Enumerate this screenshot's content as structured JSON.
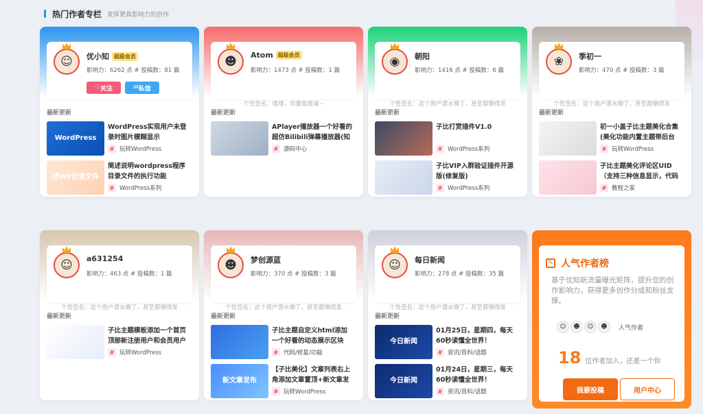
{
  "section": {
    "title": "热门作者专栏",
    "subtitle": "发挥更具影响力的创作"
  },
  "labels": {
    "recent": "最新更新",
    "stats_fmt_points": "影响力",
    "follow": "关注",
    "message": "私信"
  },
  "authors": [
    {
      "name": "优小知",
      "badge": "超级会员",
      "stats": "影响力：6262 点 # 投稿数：81 篇",
      "signature": "",
      "theme": "#2d95ee",
      "posts": [
        {
          "title": "WordPress实现用户未登录时图片模糊显示",
          "tag": "玩转WordPress",
          "thumb": "WordPress"
        },
        {
          "title": "简述说明wordpress程序目录文件的执行功能",
          "tag": "WordPress系列",
          "thumb": "述WP目录文件"
        }
      ]
    },
    {
      "name": "Atom",
      "badge": "超级会员",
      "stats": "影响力：1473 点 # 投稿数：1 篇",
      "signature": "个性签名：嘻嘻，你要我是谁~",
      "theme": "#f56b6b",
      "posts": [
        {
          "title": "APlayer播放器一个好看的超仿Bilibili弹幕播放器(知",
          "tag": "源码中心",
          "thumb": ""
        }
      ]
    },
    {
      "name": "朝阳",
      "badge": "",
      "stats": "影响力：1416 点 # 投稿数：6 篇",
      "signature": "个性签名：这个用户潜水懒了，甚至都懒得发",
      "theme": "#1dd27a",
      "posts": [
        {
          "title": "子比打赏插件V1.0",
          "tag": "WordPress系列",
          "thumb": ""
        },
        {
          "title": "子比VIP入群验证插件开源版(修复版)",
          "tag": "WordPress系列",
          "thumb": ""
        }
      ]
    },
    {
      "name": "季初一",
      "badge": "",
      "stats": "影响力：470 点 # 投稿数：3 篇",
      "signature": "个性签名：这个用户潜水懒了，甚至都懒得发",
      "theme": "#b7afa9",
      "posts": [
        {
          "title": "初一小盖子比主题美化合集(美化功能内置主题带后台",
          "tag": "玩转WordPress",
          "thumb": ""
        },
        {
          "title": "子比主题美化评论区UID（支持三种信息显示，代码",
          "tag": "教程之家",
          "thumb": ""
        }
      ]
    },
    {
      "name": "a631254",
      "badge": "",
      "stats": "影响力：463 点 # 投稿数：1 篇",
      "signature": "个性签名：这个用户潜水懒了，甚至都懒得发",
      "theme": "#d8c6b1",
      "posts": [
        {
          "title": "子比主题模板添加一个首页顶部新注册用户和会员用户",
          "tag": "玩转WordPress",
          "thumb": ""
        }
      ]
    },
    {
      "name": "梦创源蓝",
      "badge": "",
      "stats": "影响力：370 点 # 投稿数：3 篇",
      "signature": "个性签名：这个用户潜水懒了，甚至都懒得发",
      "theme": "#e7b7b7",
      "posts": [
        {
          "title": "子比主题自定义html添加一个好看的动态展示区块",
          "tag": "代码/修复/功能",
          "thumb": ""
        },
        {
          "title": "【子比美化】文章列表右上角添加文章置顶+新文章发",
          "tag": "玩转WordPress",
          "thumb": "新文章发布"
        }
      ]
    },
    {
      "name": "每日新闻",
      "badge": "",
      "stats": "影响力：278 点 # 投稿数：35 篇",
      "signature": "个性签名：这个用户潜水懒了，甚至都懒得发",
      "theme": "#cfd0dc",
      "posts": [
        {
          "title": "01月25日，星期四，每天60秒读懂全世界！",
          "tag": "资讯/百科/话题",
          "thumb": "今日新闻"
        },
        {
          "title": "01月24日，星期三，每天60秒读懂全世界！",
          "tag": "资讯/百科/话题",
          "thumb": "今日新闻"
        }
      ]
    }
  ],
  "popular": {
    "title": "人气作者榜",
    "desc": "基于优知新流量曝光矩阵，提升您的创作影响力，获得更多创作分成和粉丝支撑。",
    "avatars_label": "人气作者",
    "count": "18",
    "count_text": "位作者加入，还差一个你",
    "btn_submit": "我要投稿",
    "btn_center": "用户中心"
  },
  "colors": {
    "accent": "#1e9be8",
    "hot": "#ff7a1a"
  }
}
